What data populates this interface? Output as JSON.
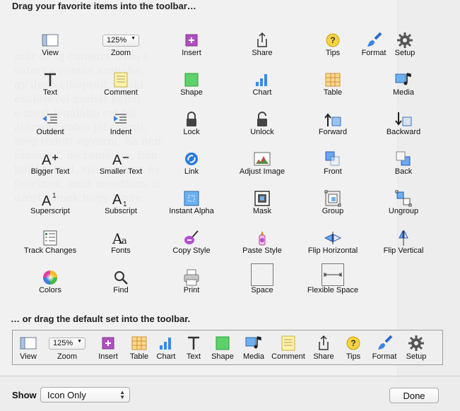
{
  "dialog": {
    "title": "Drag your favorite items into the toolbar…",
    "default_set_label": "… or drag the default set into the toolbar.",
    "show_label": "Show",
    "show_value": "Icon Only",
    "done_label": "Done"
  },
  "background": {
    "lines": [
      "már az új címedre írom a",
      "vatorka-ventes  szobába.",
      "gy ilyen elképzelt valaki",
      "esülésével  szobát  kellet",
      "e  most  legalább  ezt  túl",
      "átársom volna jól érezni,",
      "meg tudott egyezni; ha nem",
      "rásságot, de remélem, fián",
      "kollégákról, visszavágva és",
      "fejletnek, amit mondtam, is",
      "azért  remek  hogy  lenne"
    ]
  },
  "items": [
    {
      "label": "View",
      "icon": "view-icon"
    },
    {
      "label": "Zoom",
      "icon": "zoom-popup",
      "zoom": "125%"
    },
    {
      "label": "Insert",
      "icon": "insert-icon"
    },
    {
      "label": "Share",
      "icon": "share-icon"
    },
    {
      "label": "Tips",
      "icon": "tips-icon"
    },
    {
      "label": "Format",
      "icon": "format-icon"
    },
    {
      "label": "Setup",
      "icon": "gear-icon"
    },
    {
      "label": "Text",
      "icon": "text-icon"
    },
    {
      "label": "Comment",
      "icon": "comment-icon"
    },
    {
      "label": "Shape",
      "icon": "shape-icon"
    },
    {
      "label": "Chart",
      "icon": "chart-icon"
    },
    {
      "label": "Table",
      "icon": "table-icon"
    },
    {
      "label": "Media",
      "icon": "media-icon"
    },
    {
      "label": "Outdent",
      "icon": "outdent-icon"
    },
    {
      "label": "Indent",
      "icon": "indent-icon"
    },
    {
      "label": "Lock",
      "icon": "lock-icon"
    },
    {
      "label": "Unlock",
      "icon": "unlock-icon"
    },
    {
      "label": "Forward",
      "icon": "forward-icon"
    },
    {
      "label": "Backward",
      "icon": "backward-icon"
    },
    {
      "label": "Bigger Text",
      "icon": "bigger-text-icon"
    },
    {
      "label": "Smaller Text",
      "icon": "smaller-text-icon"
    },
    {
      "label": "Link",
      "icon": "link-icon"
    },
    {
      "label": "Adjust Image",
      "icon": "adjust-image-icon"
    },
    {
      "label": "Front",
      "icon": "front-icon"
    },
    {
      "label": "Back",
      "icon": "back-icon"
    },
    {
      "label": "Superscript",
      "icon": "superscript-icon"
    },
    {
      "label": "Subscript",
      "icon": "subscript-icon"
    },
    {
      "label": "Instant Alpha",
      "icon": "instant-alpha-icon"
    },
    {
      "label": "Mask",
      "icon": "mask-icon"
    },
    {
      "label": "Group",
      "icon": "group-icon"
    },
    {
      "label": "Ungroup",
      "icon": "ungroup-icon"
    },
    {
      "label": "Track Changes",
      "icon": "track-changes-icon"
    },
    {
      "label": "Fonts",
      "icon": "fonts-icon"
    },
    {
      "label": "Copy Style",
      "icon": "copy-style-icon"
    },
    {
      "label": "Paste Style",
      "icon": "paste-style-icon"
    },
    {
      "label": "Flip Horizontal",
      "icon": "flip-horizontal-icon"
    },
    {
      "label": "Flip Vertical",
      "icon": "flip-vertical-icon"
    },
    {
      "label": "Colors",
      "icon": "colors-icon"
    },
    {
      "label": "Find",
      "icon": "find-icon"
    },
    {
      "label": "Print",
      "icon": "print-icon"
    },
    {
      "label": "Space",
      "icon": "space-icon"
    },
    {
      "label": "Flexible Space",
      "icon": "flexible-space-icon"
    }
  ],
  "default_set": [
    {
      "label": "View",
      "icon": "view-icon"
    },
    {
      "label": "Zoom",
      "icon": "zoom-popup",
      "zoom": "125%"
    },
    {
      "label": "Insert",
      "icon": "insert-icon"
    },
    {
      "label": "Table",
      "icon": "table-icon"
    },
    {
      "label": "Chart",
      "icon": "chart-icon"
    },
    {
      "label": "Text",
      "icon": "text-icon"
    },
    {
      "label": "Shape",
      "icon": "shape-icon"
    },
    {
      "label": "Media",
      "icon": "media-icon"
    },
    {
      "label": "Comment",
      "icon": "comment-icon"
    },
    {
      "label": "Share",
      "icon": "share-icon"
    },
    {
      "label": "Tips",
      "icon": "tips-icon"
    },
    {
      "label": "Format",
      "icon": "format-icon"
    },
    {
      "label": "Setup",
      "icon": "gear-icon"
    }
  ]
}
